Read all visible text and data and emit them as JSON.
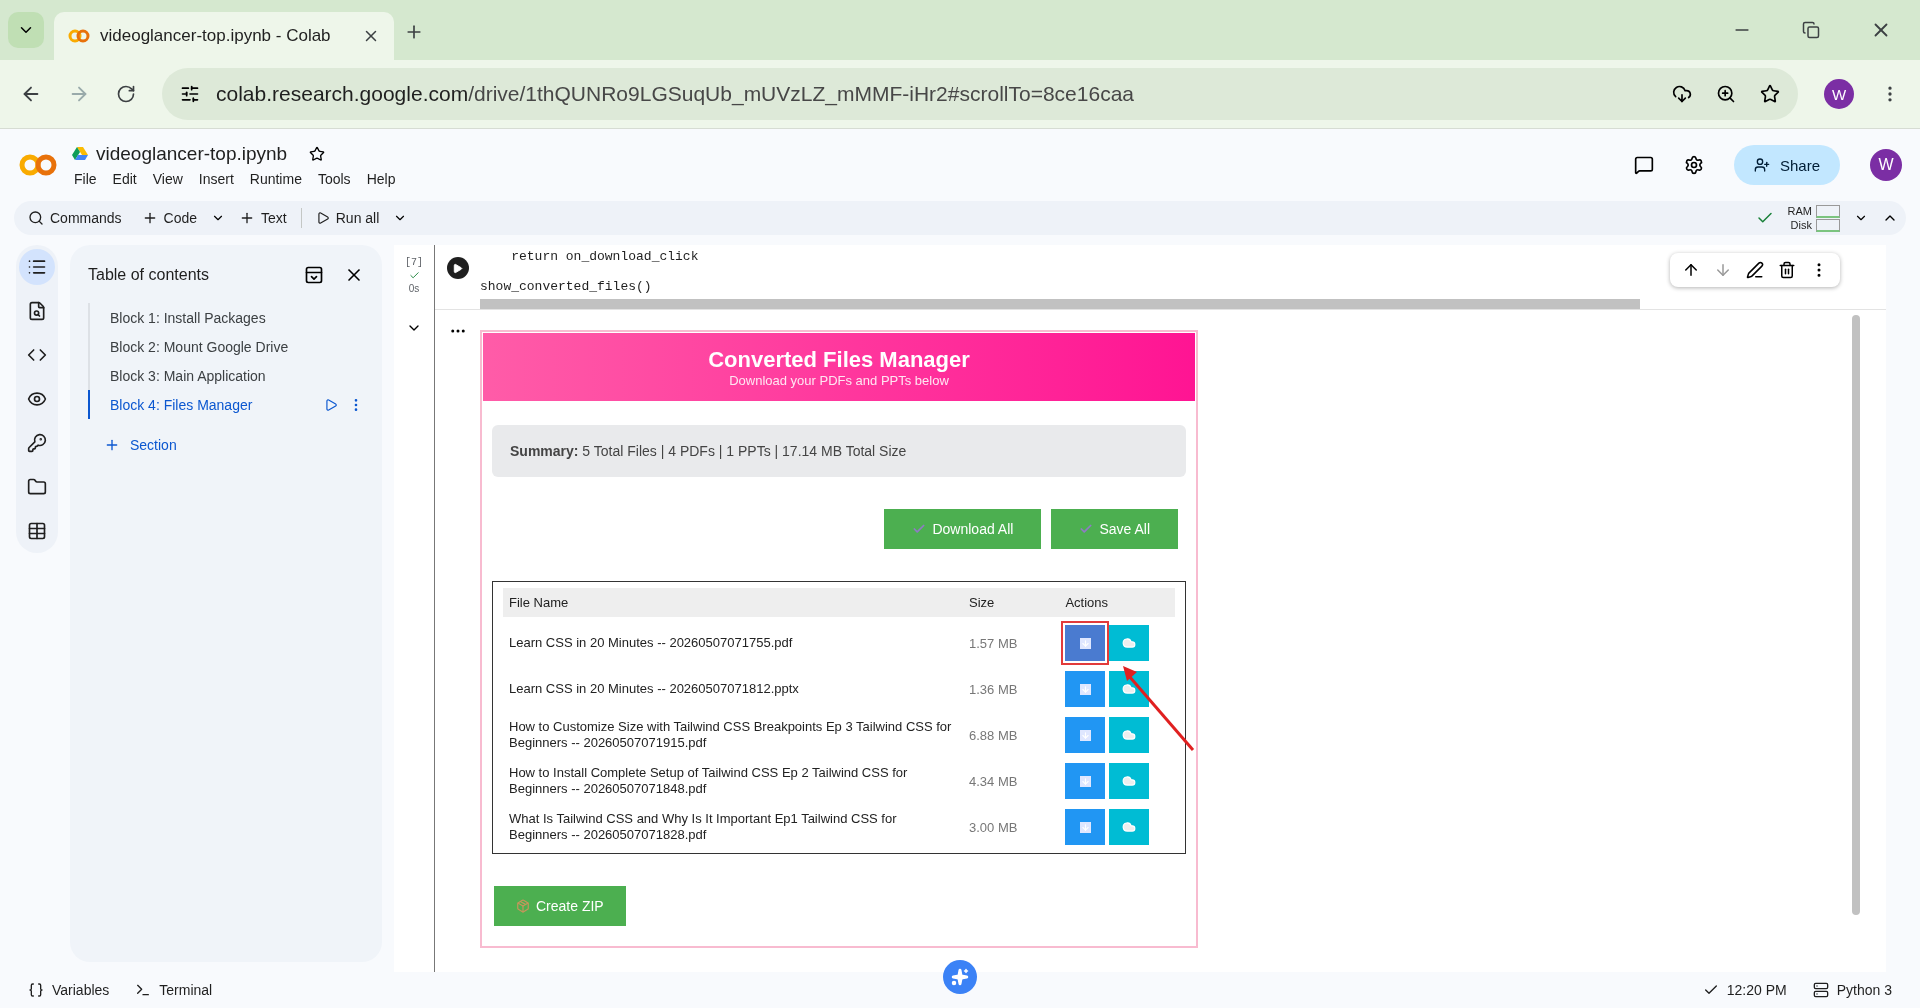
{
  "browser": {
    "tab_title": "videoglancer-top.ipynb - Colab",
    "url_host": "colab.research.google.com",
    "url_path": "/drive/1thQUNRo9LGSuqUb_mUVzLZ_mMMF-iHr2#scrollTo=8ce16caa",
    "profile": "W"
  },
  "colab": {
    "title": "videoglancer-top.ipynb",
    "menu": [
      "File",
      "Edit",
      "View",
      "Insert",
      "Runtime",
      "Tools",
      "Help"
    ],
    "share": "Share",
    "avatar": "W",
    "toolbar": [
      {
        "kind": "search",
        "label": "Commands"
      },
      {
        "kind": "add",
        "label": "Code"
      },
      {
        "kind": "add",
        "label": "Text"
      },
      {
        "kind": "run",
        "label": "Run all"
      }
    ],
    "ram": "RAM",
    "disk": "Disk"
  },
  "toc": {
    "title": "Table of contents",
    "items": [
      {
        "label": "Block 1: Install Packages",
        "selected": false
      },
      {
        "label": "Block 2: Mount Google Drive",
        "selected": false
      },
      {
        "label": "Block 3: Main Application",
        "selected": false
      },
      {
        "label": "Block 4: Files Manager",
        "selected": true
      }
    ],
    "add_section": "Section"
  },
  "cell": {
    "exec_count": "[7]",
    "duration": "0s",
    "code": [
      "    return on_download_click",
      "show_converted_files()"
    ]
  },
  "output": {
    "title": "Converted Files Manager",
    "subtitle": "Download your PDFs and PPTs below",
    "summary_label": "Summary:",
    "summary_text": "5 Total Files | 4 PDFs | 1 PPTs | 17.14 MB Total Size",
    "buttons": [
      "Download All",
      "Save All"
    ],
    "columns": [
      "File Name",
      "Size",
      "Actions"
    ],
    "rows": [
      {
        "name": "Learn CSS in 20 Minutes -- 20260507071755.pdf",
        "size": "1.57 MB",
        "highlighted": true
      },
      {
        "name": "Learn CSS in 20 Minutes -- 20260507071812.pptx",
        "size": "1.36 MB",
        "highlighted": false
      },
      {
        "name": "How to Customize Size with Tailwind CSS Breakpoints Ep 3 Tailwind CSS for Beginners -- 20260507071915.pdf",
        "size": "6.88 MB",
        "highlighted": false
      },
      {
        "name": "How to Install Complete Setup of Tailwind CSS Ep 2 Tailwind CSS for Beginners -- 20260507071848.pdf",
        "size": "4.34 MB",
        "highlighted": false
      },
      {
        "name": "What Is Tailwind CSS and Why Is It Important Ep1 Tailwind CSS for Beginners -- 20260507071828.pdf",
        "size": "3.00 MB",
        "highlighted": false
      }
    ],
    "zip_button": "Create ZIP"
  },
  "status_bar": {
    "variables": "Variables",
    "terminal": "Terminal",
    "time": "12:20 PM",
    "runtime": "Python 3"
  }
}
